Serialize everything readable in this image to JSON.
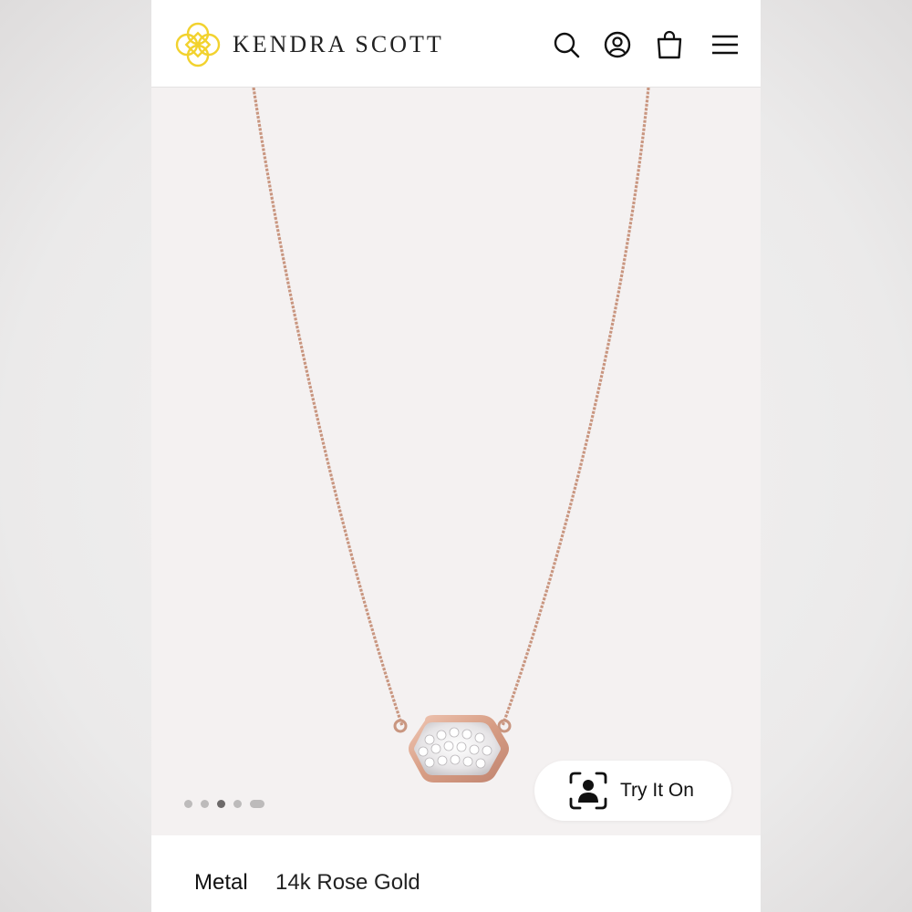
{
  "header": {
    "brand": "KENDRA SCOTT",
    "icons": [
      "search-icon",
      "account-icon",
      "shopping-bag-icon",
      "menu-icon"
    ]
  },
  "gallery": {
    "total_images": 5,
    "active_index": 3
  },
  "try_on": {
    "label": "Try It On",
    "icon": "face-scan-icon"
  },
  "product_spec": {
    "label": "Metal",
    "value": "14k Rose Gold"
  },
  "colors": {
    "logo_gold": "#f2d22e",
    "rose_gold": "#d9a48c",
    "hero_bg": "#f4f1f1"
  }
}
